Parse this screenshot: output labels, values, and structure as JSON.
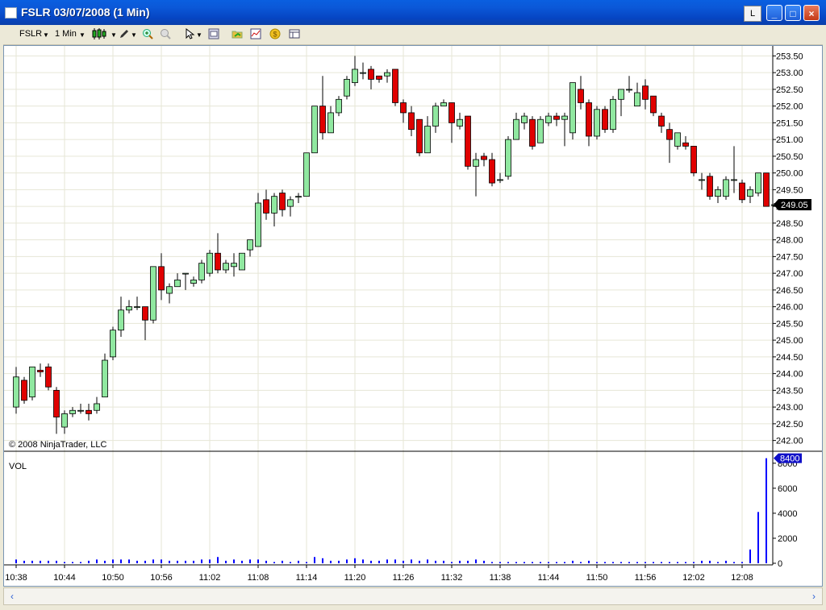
{
  "window": {
    "title": "FSLR  03/07/2008 (1 Min)",
    "link_button": "L",
    "min_glyph": "_",
    "max_glyph": "□",
    "close_glyph": "×"
  },
  "toolbar": {
    "instrument": "FSLR",
    "interval": "1 Min",
    "icons": [
      "candlestick-icon",
      "pencil-icon",
      "zoom-in-icon",
      "zoom-out-icon",
      "cursor-icon",
      "properties-icon",
      "open-folder-icon",
      "indicator-icon",
      "strategy-icon",
      "data-box-icon"
    ]
  },
  "scrollbar": {
    "left_glyph": "‹",
    "right_glyph": "›"
  },
  "chart_data": {
    "type": "candlestick",
    "instrument": "FSLR",
    "copyright": "© 2008 NinjaTrader, LLC",
    "last_price_label": "249.05",
    "price_ylim": [
      241.75,
      253.75
    ],
    "price_ticks": [
      "253.50",
      "253.00",
      "252.50",
      "252.00",
      "251.50",
      "251.00",
      "250.50",
      "250.00",
      "249.50",
      "249.00",
      "248.50",
      "248.00",
      "247.50",
      "247.00",
      "246.50",
      "246.00",
      "245.50",
      "245.00",
      "244.50",
      "244.00",
      "243.50",
      "243.00",
      "242.50",
      "242.00"
    ],
    "volume_panel_label": "VOL",
    "volume_last_label": "8400",
    "volume_ylim": [
      0,
      8700
    ],
    "volume_ticks": [
      "8000",
      "6000",
      "4000",
      "2000",
      "0"
    ],
    "time_ticks": [
      "10:38",
      "10:44",
      "10:50",
      "10:56",
      "11:02",
      "11:08",
      "11:14",
      "11:20",
      "11:26",
      "11:32",
      "11:38",
      "11:44",
      "11:50",
      "11:56",
      "12:02",
      "12:08"
    ],
    "colors": {
      "up": "#90e8a0",
      "down": "#e00000",
      "volume": "#0000ff",
      "grid": "#e6e6d6",
      "label_bg": "#000000"
    },
    "candles": [
      [
        243.0,
        243.9,
        244.2,
        242.8
      ],
      [
        243.8,
        243.2,
        243.9,
        243.1
      ],
      [
        243.3,
        244.2,
        244.2,
        243.2
      ],
      [
        244.1,
        244.05,
        244.3,
        243.9
      ],
      [
        244.2,
        243.6,
        244.3,
        243.5
      ],
      [
        243.5,
        242.7,
        243.6,
        242.2
      ],
      [
        242.4,
        242.8,
        242.9,
        242.2
      ],
      [
        242.8,
        242.9,
        243.0,
        242.7
      ],
      [
        242.9,
        242.9,
        243.1,
        242.8
      ],
      [
        242.9,
        242.8,
        243.1,
        242.6
      ],
      [
        242.9,
        243.1,
        243.3,
        242.8
      ],
      [
        243.3,
        244.4,
        244.6,
        243.3
      ],
      [
        244.5,
        245.3,
        245.4,
        244.4
      ],
      [
        245.3,
        245.9,
        246.3,
        245.1
      ],
      [
        245.9,
        246.0,
        246.2,
        245.8
      ],
      [
        246.0,
        246.0,
        246.3,
        245.9
      ],
      [
        246.0,
        245.6,
        246.0,
        245.0
      ],
      [
        245.6,
        247.2,
        247.2,
        245.5
      ],
      [
        247.2,
        246.5,
        247.6,
        246.2
      ],
      [
        246.4,
        246.6,
        246.7,
        246.1
      ],
      [
        246.6,
        246.8,
        247.0,
        246.6
      ],
      [
        247.0,
        247.0,
        247.0,
        246.5
      ],
      [
        246.7,
        246.8,
        246.9,
        246.6
      ],
      [
        246.8,
        247.3,
        247.4,
        246.7
      ],
      [
        247.0,
        247.6,
        247.7,
        246.9
      ],
      [
        247.6,
        247.1,
        248.2,
        247.0
      ],
      [
        247.1,
        247.3,
        247.4,
        247.0
      ],
      [
        247.2,
        247.3,
        247.6,
        246.9
      ],
      [
        247.1,
        247.6,
        247.6,
        247.1
      ],
      [
        247.7,
        248.0,
        248.0,
        247.5
      ],
      [
        247.8,
        249.1,
        249.4,
        247.8
      ],
      [
        249.2,
        248.8,
        249.5,
        248.6
      ],
      [
        248.8,
        249.3,
        249.4,
        248.4
      ],
      [
        249.4,
        248.9,
        249.5,
        248.7
      ],
      [
        249.0,
        249.2,
        249.3,
        248.7
      ],
      [
        249.3,
        249.3,
        249.4,
        249.1
      ],
      [
        249.3,
        250.6,
        250.6,
        249.3
      ],
      [
        250.6,
        252.0,
        252.0,
        250.6
      ],
      [
        252.0,
        251.2,
        252.9,
        251.0
      ],
      [
        251.2,
        251.8,
        252.0,
        251.2
      ],
      [
        251.8,
        252.2,
        252.3,
        251.7
      ],
      [
        252.3,
        252.8,
        252.9,
        252.2
      ],
      [
        252.7,
        253.1,
        253.5,
        252.6
      ],
      [
        253.0,
        253.0,
        253.3,
        252.8
      ],
      [
        253.1,
        252.8,
        253.2,
        252.5
      ],
      [
        252.9,
        252.8,
        252.9,
        252.7
      ],
      [
        252.9,
        253.0,
        253.1,
        252.7
      ],
      [
        253.1,
        252.1,
        253.1,
        252.0
      ],
      [
        252.1,
        251.8,
        252.2,
        251.5
      ],
      [
        251.8,
        251.3,
        252.0,
        251.1
      ],
      [
        251.6,
        250.6,
        251.6,
        250.5
      ],
      [
        250.6,
        251.4,
        251.7,
        250.6
      ],
      [
        251.4,
        252.0,
        252.1,
        251.2
      ],
      [
        252.0,
        252.1,
        252.2,
        252.0
      ],
      [
        252.1,
        251.5,
        252.1,
        250.9
      ],
      [
        251.4,
        251.6,
        251.8,
        251.3
      ],
      [
        251.7,
        250.2,
        251.7,
        250.1
      ],
      [
        250.2,
        250.4,
        250.6,
        249.3
      ],
      [
        250.5,
        250.4,
        250.6,
        250.2
      ],
      [
        250.4,
        249.7,
        250.6,
        249.6
      ],
      [
        249.8,
        249.8,
        250.0,
        249.7
      ],
      [
        249.9,
        251.0,
        251.1,
        249.8
      ],
      [
        251.0,
        251.6,
        251.8,
        251.0
      ],
      [
        251.5,
        251.7,
        251.8,
        251.3
      ],
      [
        251.6,
        250.8,
        251.7,
        250.7
      ],
      [
        250.9,
        251.6,
        251.7,
        251.0
      ],
      [
        251.5,
        251.7,
        251.8,
        251.4
      ],
      [
        251.7,
        251.6,
        251.8,
        251.4
      ],
      [
        251.6,
        251.7,
        251.8,
        250.8
      ],
      [
        251.2,
        252.7,
        252.7,
        251.0
      ],
      [
        252.5,
        252.1,
        252.9,
        251.9
      ],
      [
        252.1,
        251.1,
        252.2,
        250.8
      ],
      [
        251.1,
        251.9,
        252.0,
        251.0
      ],
      [
        251.9,
        251.3,
        252.0,
        251.2
      ],
      [
        251.3,
        252.2,
        252.3,
        251.2
      ],
      [
        252.2,
        252.5,
        252.5,
        251.7
      ],
      [
        252.5,
        252.5,
        252.9,
        252.4
      ],
      [
        252.0,
        252.4,
        252.7,
        252.0
      ],
      [
        252.6,
        252.2,
        252.8,
        251.9
      ],
      [
        252.3,
        251.8,
        252.3,
        251.7
      ],
      [
        251.7,
        251.4,
        251.8,
        251.2
      ],
      [
        251.3,
        251.0,
        251.5,
        250.3
      ],
      [
        250.8,
        251.2,
        251.2,
        250.7
      ],
      [
        250.9,
        250.8,
        251.1,
        250.7
      ],
      [
        250.8,
        250.0,
        250.8,
        249.9
      ],
      [
        249.8,
        249.8,
        250.0,
        249.5
      ],
      [
        249.9,
        249.3,
        250.0,
        249.2
      ],
      [
        249.3,
        249.5,
        249.6,
        249.1
      ],
      [
        249.3,
        249.8,
        249.9,
        249.2
      ],
      [
        249.8,
        249.8,
        250.8,
        249.4
      ],
      [
        249.7,
        249.2,
        249.8,
        249.1
      ],
      [
        249.3,
        249.5,
        249.6,
        249.1
      ],
      [
        249.4,
        250.0,
        250.0,
        249.3
      ],
      [
        250.0,
        249.0,
        250.0,
        249.0
      ],
      [
        249.05,
        249.05,
        249.1,
        249.0
      ]
    ],
    "volume": [
      300,
      200,
      200,
      200,
      200,
      200,
      100,
      100,
      100,
      200,
      300,
      200,
      300,
      300,
      300,
      200,
      200,
      300,
      300,
      200,
      200,
      200,
      200,
      300,
      300,
      500,
      200,
      300,
      200,
      300,
      300,
      200,
      100,
      200,
      100,
      200,
      100,
      500,
      400,
      200,
      200,
      300,
      400,
      300,
      200,
      200,
      300,
      300,
      200,
      300,
      200,
      300,
      200,
      200,
      100,
      200,
      200,
      300,
      200,
      100,
      100,
      100,
      100,
      100,
      100,
      100,
      100,
      100,
      100,
      200,
      100,
      200,
      100,
      100,
      100,
      100,
      100,
      100,
      100,
      100,
      100,
      100,
      100,
      100,
      100,
      200,
      200,
      100,
      200,
      100,
      100,
      1100,
      4100,
      8400
    ],
    "volume_start_index": 0
  }
}
